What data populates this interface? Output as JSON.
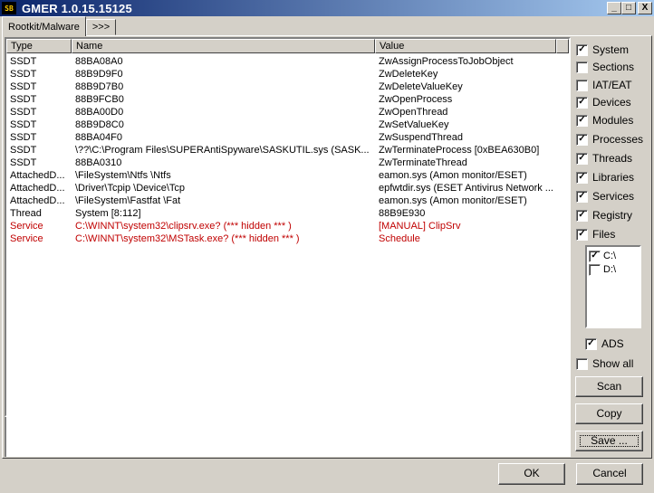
{
  "window": {
    "title": "GMER 1.0.15.15125",
    "icon_text": "SB",
    "controls": {
      "minimize": "_",
      "maximize": "□",
      "close": "X"
    }
  },
  "tabs": [
    {
      "label": "Rootkit/Malware"
    },
    {
      "label": ">>>"
    }
  ],
  "list": {
    "columns": [
      "Type",
      "Name",
      "Value"
    ],
    "rows": [
      {
        "type": "SSDT",
        "name": "88BA08A0",
        "value": "ZwAssignProcessToJobObject",
        "hidden": false
      },
      {
        "type": "SSDT",
        "name": "88B9D9F0",
        "value": "ZwDeleteKey",
        "hidden": false
      },
      {
        "type": "SSDT",
        "name": "88B9D7B0",
        "value": "ZwDeleteValueKey",
        "hidden": false
      },
      {
        "type": "SSDT",
        "name": "88B9FCB0",
        "value": "ZwOpenProcess",
        "hidden": false
      },
      {
        "type": "SSDT",
        "name": "88BA00D0",
        "value": "ZwOpenThread",
        "hidden": false
      },
      {
        "type": "SSDT",
        "name": "88B9D8C0",
        "value": "ZwSetValueKey",
        "hidden": false
      },
      {
        "type": "SSDT",
        "name": "88BA04F0",
        "value": "ZwSuspendThread",
        "hidden": false
      },
      {
        "type": "SSDT",
        "name": "\\??\\C:\\Program Files\\SUPERAntiSpyware\\SASKUTIL.sys (SASK...",
        "value": "ZwTerminateProcess [0xBEA630B0]",
        "hidden": false
      },
      {
        "type": "SSDT",
        "name": "88BA0310",
        "value": "ZwTerminateThread",
        "hidden": false
      },
      {
        "type": "AttachedD...",
        "name": "\\FileSystem\\Ntfs \\Ntfs",
        "value": "eamon.sys (Amon monitor/ESET)",
        "hidden": false
      },
      {
        "type": "AttachedD...",
        "name": "\\Driver\\Tcpip \\Device\\Tcp",
        "value": "epfwtdir.sys (ESET Antivirus Network ...",
        "hidden": false
      },
      {
        "type": "AttachedD...",
        "name": "\\FileSystem\\Fastfat \\Fat",
        "value": "eamon.sys (Amon monitor/ESET)",
        "hidden": false
      },
      {
        "type": "Thread",
        "name": "System [8:112]",
        "value": "88B9E930",
        "hidden": false
      },
      {
        "type": "Service",
        "name": "C:\\WINNT\\system32\\clipsrv.exe? (*** hidden *** )",
        "value": "[MANUAL] ClipSrv",
        "hidden": true
      },
      {
        "type": "Service",
        "name": "C:\\WINNT\\system32\\MSTask.exe? (*** hidden *** )",
        "value": "Schedule",
        "hidden": true
      }
    ]
  },
  "options": [
    {
      "label": "System",
      "checked": true
    },
    {
      "label": "Sections",
      "checked": false
    },
    {
      "label": "IAT/EAT",
      "checked": false
    },
    {
      "label": "Devices",
      "checked": true
    },
    {
      "label": "Modules",
      "checked": true
    },
    {
      "label": "Processes",
      "checked": true
    },
    {
      "label": "Threads",
      "checked": true
    },
    {
      "label": "Libraries",
      "checked": true
    },
    {
      "label": "Services",
      "checked": true
    },
    {
      "label": "Registry",
      "checked": true
    },
    {
      "label": "Files",
      "checked": true
    }
  ],
  "drives": [
    {
      "label": "C:\\",
      "checked": true
    },
    {
      "label": "D:\\",
      "checked": false
    }
  ],
  "ads": {
    "label": "ADS",
    "checked": true
  },
  "show_all": {
    "label": "Show all",
    "checked": false
  },
  "buttons": {
    "scan": "Scan",
    "copy": "Copy",
    "save": "Save ...",
    "ok": "OK",
    "cancel": "Cancel"
  },
  "colors": {
    "hidden_row": "#c00000",
    "titlebar_start": "#0a246a",
    "titlebar_end": "#a6caf0"
  }
}
